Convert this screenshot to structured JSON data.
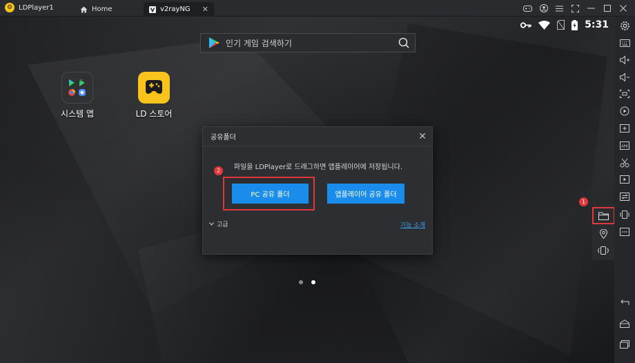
{
  "titlebar": {
    "app_title": "LDPlayer1",
    "tabs": [
      {
        "label": "Home"
      },
      {
        "label": "v2rayNG"
      }
    ]
  },
  "statusbar": {
    "time": "5:31"
  },
  "search": {
    "placeholder": "인기 게임 검색하기"
  },
  "desktop": {
    "icons": [
      {
        "label": "시스템 앱",
        "icon": "system-apps-icon"
      },
      {
        "label": "LD 스토어",
        "icon": "ld-store-icon"
      }
    ],
    "pages": 2,
    "active_page": 2
  },
  "dialog": {
    "title": "공유폴더",
    "description": "파일을 LDPlayer로 드래그하면 앱플레이어에 저장됩니다.",
    "pc_button": "PC 공유 폴더",
    "app_button": "앱플레이어 공유 폴더",
    "advanced_label": "고급",
    "link_label": "기능 소개"
  },
  "annotations": {
    "badge1": "1",
    "badge2": "2",
    "highlight_color": "#e0383b"
  },
  "colors": {
    "primary_button": "#1a8ceb",
    "ld_store_yellow": "#f7c31c"
  }
}
